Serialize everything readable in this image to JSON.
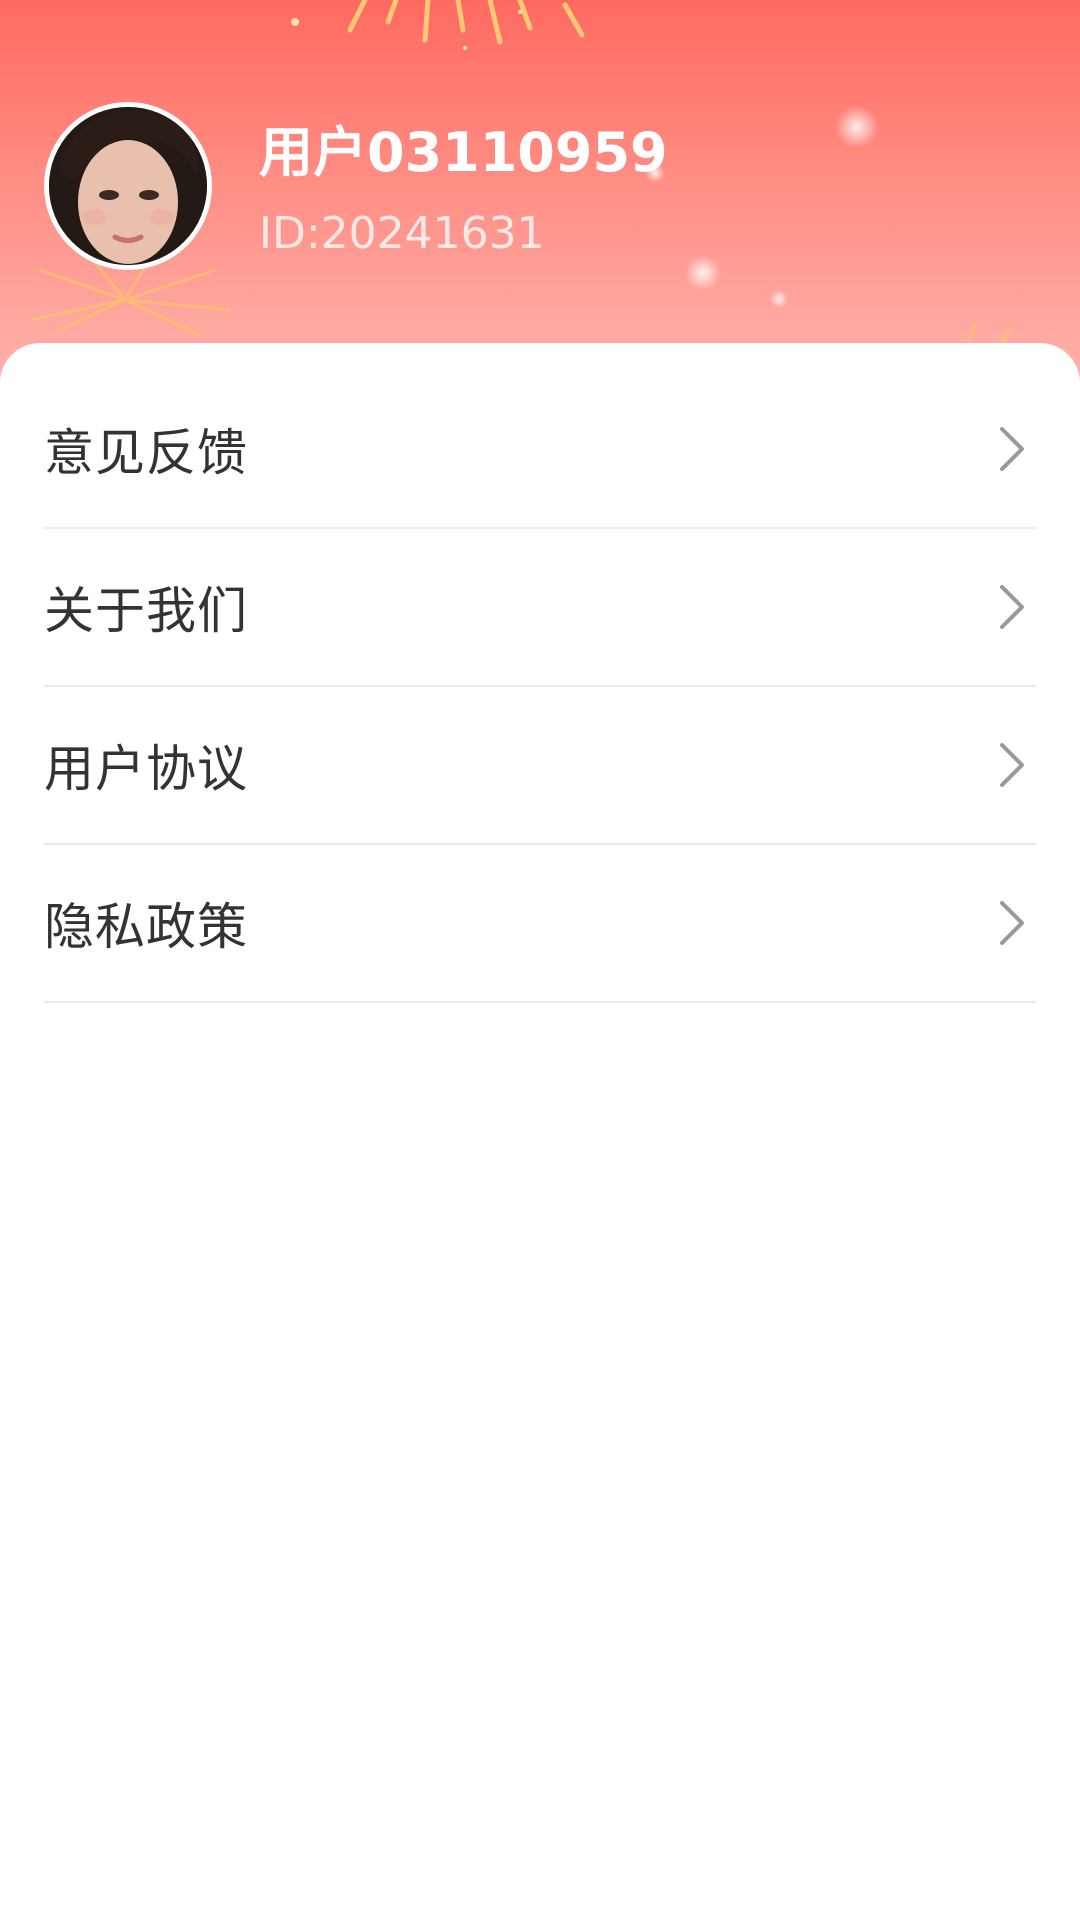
{
  "profile": {
    "username": "用户03110959",
    "user_id": "ID:20241631"
  },
  "menu": {
    "items": [
      {
        "label": "意见反馈",
        "icon": "chevron-right-icon"
      },
      {
        "label": "关于我们",
        "icon": "chevron-right-icon"
      },
      {
        "label": "用户协议",
        "icon": "chevron-right-icon"
      },
      {
        "label": "隐私政策",
        "icon": "chevron-right-icon"
      }
    ]
  },
  "colors": {
    "header_top": "#ff6a60",
    "header_bottom": "#ffb2ab",
    "text_primary": "#333333",
    "chevron": "#999999",
    "divider": "#ebebeb"
  }
}
